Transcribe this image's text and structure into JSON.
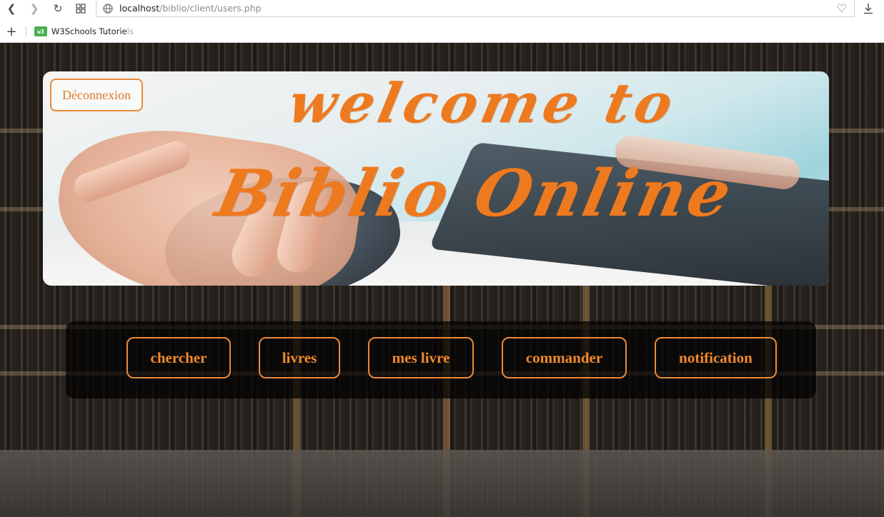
{
  "browser": {
    "url_host": "localhost",
    "url_path": "/biblio/client/users.php",
    "bookmark_label_main": "W3Schools Tutorie",
    "bookmark_label_fade": "ls",
    "bookmark_icon_text": "w3"
  },
  "banner": {
    "title_line1": "welcome to",
    "title_line2": "Biblio Online",
    "logout_label": "Déconnexion"
  },
  "menu": {
    "items": [
      {
        "label": "chercher"
      },
      {
        "label": "livres"
      },
      {
        "label": "mes livre"
      },
      {
        "label": "commander"
      },
      {
        "label": "notification"
      }
    ]
  },
  "colors": {
    "accent": "#ee7a1f",
    "button_border": "#e98a3a",
    "panel_bg": "#000000"
  }
}
